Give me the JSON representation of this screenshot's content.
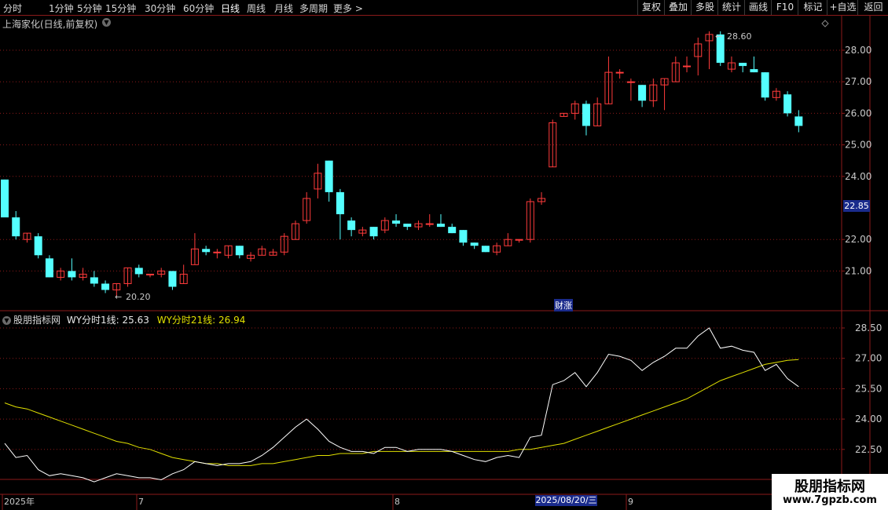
{
  "toolbar": {
    "periods": [
      "分时",
      "1分钟",
      "5分钟",
      "15分钟",
      "30分钟",
      "60分钟",
      "日线",
      "周线",
      "月线",
      "多周期",
      "更多 >"
    ],
    "active_period": "日线",
    "right_buttons": [
      "复权",
      "叠加",
      "多股",
      "统计",
      "画线",
      "F10",
      "标记",
      "+自选",
      "返回"
    ]
  },
  "stock": {
    "title": "上海家化(日线,前复权)"
  },
  "price_axis": {
    "ticks": [
      "28.00",
      "27.00",
      "26.00",
      "25.00",
      "24.00",
      "22.00",
      "21.00"
    ],
    "current_price": "22.85"
  },
  "annotations": {
    "high_label": "28.60",
    "low_label": "20.20",
    "event_label": "财涨"
  },
  "indicator": {
    "name": "股朋指标网",
    "line1_label": "WY分时1线: 25.63",
    "line2_label": "WY分时21线: 26.94",
    "axis_ticks": [
      "28.50",
      "27.00",
      "25.50",
      "24.00",
      "22.50"
    ]
  },
  "time_axis": {
    "labels": [
      "2025年",
      "7",
      "8",
      "9"
    ],
    "cursor_date": "2025/08/20/三"
  },
  "watermark": {
    "line1": "股朋指标网",
    "line2": "www.7gpzb.com"
  },
  "colors": {
    "up": "#ff3b3b",
    "down": "#54ffff",
    "grid": "#8b1a1a",
    "line1": "#ffffff",
    "line2": "#e0e000"
  },
  "chart_data": {
    "type": "candlestick",
    "price_range": [
      20.0,
      28.9
    ],
    "candles": [
      [
        23.9,
        22.7,
        23.9,
        22.7
      ],
      [
        22.7,
        22.1,
        22.9,
        22.0
      ],
      [
        22.0,
        22.2,
        22.2,
        21.9
      ],
      [
        22.1,
        21.5,
        22.2,
        21.4
      ],
      [
        21.4,
        20.8,
        21.5,
        20.8
      ],
      [
        20.8,
        21.0,
        21.1,
        20.7
      ],
      [
        21.0,
        20.8,
        21.4,
        20.7
      ],
      [
        20.8,
        20.9,
        21.1,
        20.7
      ],
      [
        20.8,
        20.6,
        21.0,
        20.5
      ],
      [
        20.6,
        20.4,
        20.7,
        20.3
      ],
      [
        20.4,
        20.6,
        20.6,
        20.2
      ],
      [
        20.6,
        21.1,
        21.1,
        20.5
      ],
      [
        21.1,
        20.9,
        21.2,
        20.8
      ],
      [
        20.9,
        20.9,
        20.9,
        20.8
      ],
      [
        20.9,
        21.0,
        21.1,
        20.8
      ],
      [
        21.0,
        20.5,
        21.0,
        20.4
      ],
      [
        20.6,
        20.9,
        21.2,
        20.6
      ],
      [
        21.2,
        21.7,
        22.2,
        21.2
      ],
      [
        21.7,
        21.6,
        21.8,
        21.5
      ],
      [
        21.6,
        21.6,
        21.7,
        21.4
      ],
      [
        21.5,
        21.8,
        21.8,
        21.4
      ],
      [
        21.8,
        21.5,
        21.8,
        21.4
      ],
      [
        21.4,
        21.5,
        21.6,
        21.3
      ],
      [
        21.5,
        21.7,
        21.8,
        21.5
      ],
      [
        21.5,
        21.6,
        21.7,
        21.5
      ],
      [
        21.6,
        22.1,
        22.2,
        21.5
      ],
      [
        22.0,
        22.5,
        22.6,
        22.0
      ],
      [
        22.6,
        23.3,
        23.5,
        22.5
      ],
      [
        23.6,
        24.1,
        24.4,
        23.3
      ],
      [
        24.5,
        23.5,
        24.5,
        23.2
      ],
      [
        23.5,
        22.8,
        23.6,
        22.0
      ],
      [
        22.6,
        22.3,
        22.7,
        22.1
      ],
      [
        22.2,
        22.3,
        22.4,
        22.1
      ],
      [
        22.4,
        22.1,
        22.4,
        22.0
      ],
      [
        22.3,
        22.6,
        22.7,
        22.2
      ],
      [
        22.6,
        22.5,
        22.8,
        22.4
      ],
      [
        22.5,
        22.4,
        22.5,
        22.3
      ],
      [
        22.4,
        22.5,
        22.6,
        22.3
      ],
      [
        22.5,
        22.5,
        22.8,
        22.4
      ],
      [
        22.5,
        22.4,
        22.8,
        22.4
      ],
      [
        22.4,
        22.2,
        22.5,
        22.2
      ],
      [
        22.3,
        21.9,
        22.3,
        21.8
      ],
      [
        21.9,
        21.8,
        21.9,
        21.7
      ],
      [
        21.8,
        21.6,
        21.8,
        21.6
      ],
      [
        21.6,
        21.8,
        21.9,
        21.5
      ],
      [
        21.8,
        22.0,
        22.2,
        21.8
      ],
      [
        22.0,
        22.0,
        22.0,
        21.9
      ],
      [
        22.0,
        23.2,
        23.3,
        21.9
      ],
      [
        23.2,
        23.3,
        23.5,
        23.1
      ],
      [
        24.3,
        25.7,
        25.8,
        24.3
      ],
      [
        25.9,
        26.0,
        26.0,
        25.9
      ],
      [
        26.0,
        26.3,
        26.4,
        25.8
      ],
      [
        26.3,
        25.6,
        26.4,
        25.3
      ],
      [
        25.6,
        26.3,
        26.5,
        25.6
      ],
      [
        26.3,
        27.3,
        27.8,
        26.3
      ],
      [
        27.3,
        27.3,
        27.4,
        27.1
      ],
      [
        27.0,
        27.0,
        27.1,
        26.4
      ],
      [
        26.9,
        26.4,
        26.9,
        26.2
      ],
      [
        26.4,
        26.9,
        27.1,
        26.2
      ],
      [
        26.9,
        27.1,
        27.1,
        26.1
      ],
      [
        27.0,
        27.6,
        27.8,
        27.0
      ],
      [
        27.5,
        27.5,
        27.8,
        27.3
      ],
      [
        27.8,
        28.2,
        28.4,
        27.2
      ],
      [
        28.3,
        28.5,
        28.6,
        27.4
      ],
      [
        28.5,
        27.6,
        28.6,
        27.5
      ],
      [
        27.4,
        27.6,
        27.8,
        27.3
      ],
      [
        27.6,
        27.5,
        27.6,
        27.3
      ],
      [
        27.4,
        27.3,
        27.8,
        27.3
      ],
      [
        27.3,
        26.5,
        27.3,
        26.4
      ],
      [
        26.5,
        26.7,
        26.8,
        26.4
      ],
      [
        26.6,
        26.0,
        26.7,
        25.9
      ],
      [
        25.9,
        25.6,
        26.1,
        25.4
      ]
    ],
    "indicator_series": [
      {
        "name": "WY分时1线",
        "values": [
          22.8,
          22.1,
          22.2,
          21.5,
          21.2,
          21.3,
          21.2,
          21.1,
          20.9,
          21.1,
          21.3,
          21.2,
          21.1,
          21.1,
          21.0,
          21.3,
          21.5,
          21.9,
          21.8,
          21.7,
          21.8,
          21.8,
          21.9,
          22.2,
          22.6,
          23.1,
          23.6,
          24.0,
          23.5,
          22.9,
          22.6,
          22.4,
          22.4,
          22.3,
          22.6,
          22.6,
          22.4,
          22.5,
          22.5,
          22.5,
          22.4,
          22.2,
          22.0,
          21.9,
          22.1,
          22.2,
          22.1,
          23.1,
          23.2,
          25.7,
          25.9,
          26.3,
          25.6,
          26.3,
          27.2,
          27.1,
          26.9,
          26.4,
          26.8,
          27.1,
          27.5,
          27.5,
          28.1,
          28.5,
          27.5,
          27.6,
          27.4,
          27.3,
          26.4,
          26.7,
          26.0,
          25.6
        ]
      },
      {
        "name": "WY分时21线",
        "values": [
          24.8,
          24.6,
          24.5,
          24.3,
          24.1,
          23.9,
          23.7,
          23.5,
          23.3,
          23.1,
          22.9,
          22.8,
          22.6,
          22.5,
          22.3,
          22.1,
          22.0,
          21.9,
          21.8,
          21.8,
          21.7,
          21.7,
          21.7,
          21.8,
          21.8,
          21.9,
          22.0,
          22.1,
          22.2,
          22.2,
          22.3,
          22.3,
          22.3,
          22.4,
          22.4,
          22.4,
          22.4,
          22.4,
          22.4,
          22.4,
          22.4,
          22.4,
          22.4,
          22.4,
          22.4,
          22.4,
          22.5,
          22.5,
          22.6,
          22.7,
          22.8,
          23.0,
          23.2,
          23.4,
          23.6,
          23.8,
          24.0,
          24.2,
          24.4,
          24.6,
          24.8,
          25.0,
          25.3,
          25.6,
          25.9,
          26.1,
          26.3,
          26.5,
          26.7,
          26.8,
          26.9,
          26.94
        ]
      }
    ],
    "indicator_range": [
      21.0,
      28.9
    ]
  }
}
